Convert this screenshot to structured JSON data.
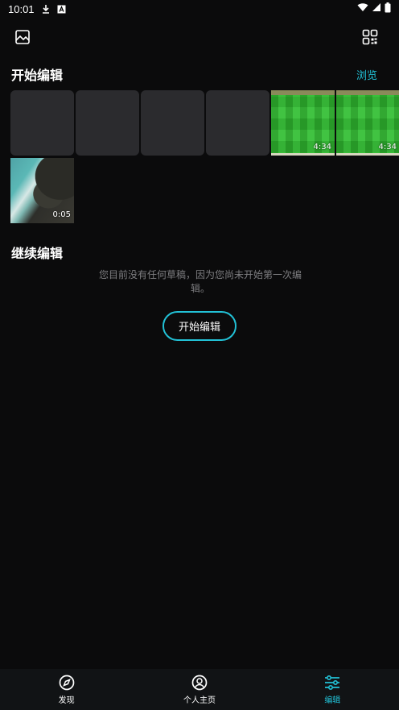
{
  "status_bar": {
    "time": "10:01",
    "icons": [
      "download-icon",
      "a-badge-icon",
      "wifi-icon",
      "signal-icon",
      "battery-icon"
    ]
  },
  "toolbar": {
    "left_icon": "gallery-icon",
    "right_icon": "qr-scan-icon"
  },
  "start_section": {
    "title": "开始编辑",
    "browse_label": "浏览",
    "thumbnails": [
      {
        "kind": "empty",
        "duration": ""
      },
      {
        "kind": "empty",
        "duration": ""
      },
      {
        "kind": "empty",
        "duration": ""
      },
      {
        "kind": "empty",
        "duration": ""
      },
      {
        "kind": "game",
        "duration": "4:34"
      },
      {
        "kind": "game",
        "duration": "4:34"
      },
      {
        "kind": "coast",
        "duration": "0:05"
      }
    ]
  },
  "continue_section": {
    "title": "继续编辑",
    "empty_message": "您目前没有任何草稿，因为您尚未开始第一次编辑。",
    "start_button": "开始编辑"
  },
  "bottom_nav": {
    "items": [
      {
        "label": "发现",
        "icon": "compass-icon",
        "active": false
      },
      {
        "label": "个人主页",
        "icon": "profile-icon",
        "active": false
      },
      {
        "label": "编辑",
        "icon": "sliders-icon",
        "active": true
      }
    ]
  },
  "colors": {
    "accent": "#22c1d6",
    "background": "#0b0b0c",
    "nav_background": "#111315",
    "muted_text": "#7d7d80"
  }
}
